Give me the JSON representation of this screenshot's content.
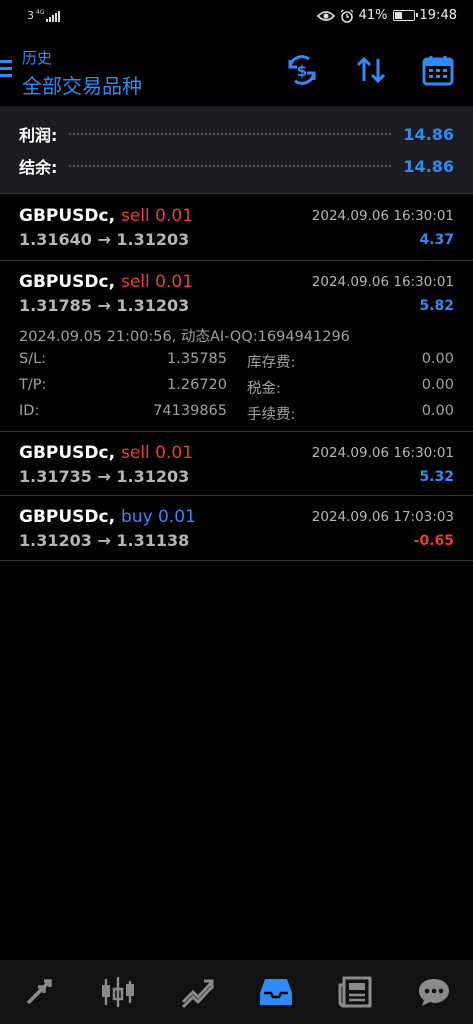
{
  "status_bar": {
    "carrier": "3",
    "network": "4G",
    "battery_percent": "41%",
    "battery_level": 0.41,
    "time": "19:48"
  },
  "header": {
    "subtitle": "历史",
    "title": "全部交易品种",
    "accent_color": "#2f8af7",
    "icons": [
      "dollar-swap-icon",
      "sort-icon",
      "calendar-icon"
    ]
  },
  "summary": {
    "profit_label": "利润:",
    "profit_value": "14.86",
    "balance_label": "结余:",
    "balance_value": "14.86"
  },
  "deals": [
    {
      "symbol": "GBPUSDc,",
      "side": "sell 0.01",
      "prices": "1.31640 → 1.31203",
      "time": "2024.09.06 16:30:01",
      "profit": "4.37"
    },
    {
      "symbol": "GBPUSDc,",
      "side": "sell 0.01",
      "prices": "1.31785 → 1.31203",
      "time": "2024.09.06 16:30:01",
      "profit": "5.82",
      "expanded": {
        "open_info": "2024.09.05 21:00:56, 动态AI-QQ:1694941296",
        "sl_label": "S/L:",
        "sl_value": "1.35785",
        "swap_label": "库存费:",
        "swap_value": "0.00",
        "tp_label": "T/P:",
        "tp_value": "1.26720",
        "tax_label": "税金:",
        "tax_value": "0.00",
        "id_label": "ID:",
        "id_value": "74139865",
        "fee_label": "手续费:",
        "fee_value": "0.00"
      }
    },
    {
      "symbol": "GBPUSDc,",
      "side": "sell 0.01",
      "prices": "1.31735 → 1.31203",
      "time": "2024.09.06 16:30:01",
      "profit": "5.32"
    },
    {
      "symbol": "GBPUSDc,",
      "side": "buy 0.01",
      "prices": "1.31203 → 1.31138",
      "time": "2024.09.06 17:03:03",
      "profit": "-0.65"
    }
  ],
  "colors": {
    "sell": "#e83b3b",
    "buy": "#2f8af7",
    "positive": "#2f8af7",
    "negative": "#e83b3b"
  },
  "bottom_nav": [
    "quotes-icon",
    "chart-icon",
    "trade-icon",
    "history-icon",
    "news-icon",
    "chat-icon"
  ]
}
